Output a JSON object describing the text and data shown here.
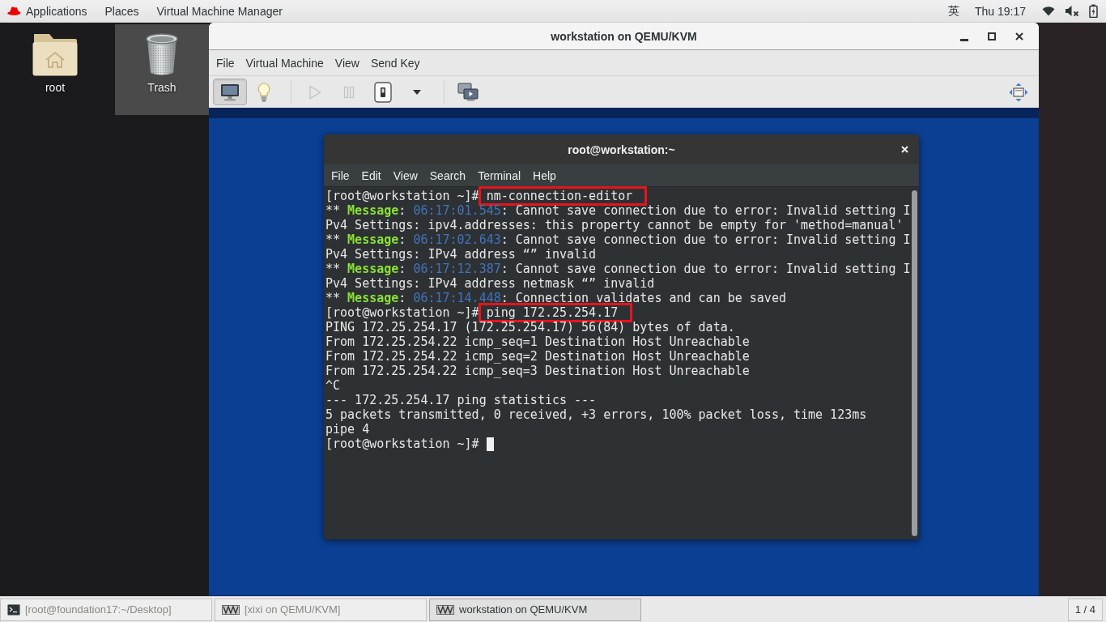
{
  "top_bar": {
    "menus": [
      "Applications",
      "Places",
      "Virtual Machine Manager"
    ],
    "input_method": "英",
    "clock": "Thu 19:17"
  },
  "desktop_icons": [
    {
      "label": "root",
      "selected": false
    },
    {
      "label": "Trash",
      "selected": true
    }
  ],
  "vm_window": {
    "title": "workstation on QEMU/KVM",
    "menu": [
      "File",
      "Virtual Machine",
      "View",
      "Send Key"
    ],
    "toolbar": {
      "groups": [
        {
          "buttons": [
            {
              "selected": true,
              "disabled": false
            },
            {
              "selected": false,
              "disabled": false
            }
          ]
        },
        {
          "buttons": [
            {
              "selected": false,
              "disabled": true
            },
            {
              "selected": false,
              "disabled": true
            },
            {
              "selected": false,
              "disabled": false
            },
            {
              "selected": false,
              "disabled": false
            }
          ]
        },
        {
          "buttons": [
            {
              "selected": false,
              "disabled": false
            }
          ]
        }
      ],
      "end_buttons": [
        {
          "selected": false,
          "disabled": false
        }
      ]
    },
    "terminal": {
      "title": "root@workstation:~",
      "menu": [
        "File",
        "Edit",
        "View",
        "Search",
        "Terminal",
        "Help"
      ],
      "lines": [
        {
          "kind": "prompt",
          "prompt": "[root@workstation ~]#",
          "command": "nm-connection-editor",
          "highlighted": true,
          "cursor": false
        },
        {
          "kind": "message",
          "segments": [
            "** ",
            "Message",
            ": ",
            "06:17:01.545",
            ": Cannot save connection due to error: Invalid setting I"
          ]
        },
        {
          "kind": "output",
          "text": "Pv4 Settings: ipv4.addresses: this property cannot be empty for 'method=manual'"
        },
        {
          "kind": "message",
          "segments": [
            "** ",
            "Message",
            ": ",
            "06:17:02.643",
            ": Cannot save connection due to error: Invalid setting I"
          ]
        },
        {
          "kind": "output",
          "text": "Pv4 Settings: IPv4 address “” invalid"
        },
        {
          "kind": "message",
          "segments": [
            "** ",
            "Message",
            ": ",
            "06:17:12.387",
            ": Cannot save connection due to error: Invalid setting I"
          ]
        },
        {
          "kind": "output",
          "text": "Pv4 Settings: IPv4 address netmask “” invalid"
        },
        {
          "kind": "message",
          "segments": [
            "** ",
            "Message",
            ": ",
            "06:17:14.448",
            ": Connection validates and can be saved"
          ]
        },
        {
          "kind": "prompt",
          "prompt": "[root@workstation ~]#",
          "command": "ping 172.25.254.17",
          "highlighted": true,
          "cursor": false
        },
        {
          "kind": "output",
          "text": "PING 172.25.254.17 (172.25.254.17) 56(84) bytes of data."
        },
        {
          "kind": "output",
          "text": "From 172.25.254.22 icmp_seq=1 Destination Host Unreachable"
        },
        {
          "kind": "output",
          "text": "From 172.25.254.22 icmp_seq=2 Destination Host Unreachable"
        },
        {
          "kind": "output",
          "text": "From 172.25.254.22 icmp_seq=3 Destination Host Unreachable"
        },
        {
          "kind": "output",
          "text": "^C"
        },
        {
          "kind": "output",
          "text": "--- 172.25.254.17 ping statistics ---"
        },
        {
          "kind": "output",
          "text": "5 packets transmitted, 0 received, +3 errors, 100% packet loss, time 123ms"
        },
        {
          "kind": "output",
          "text": "pipe 4"
        },
        {
          "kind": "prompt",
          "prompt": "[root@workstation ~]#",
          "highlighted": false,
          "cursor": true
        }
      ]
    }
  },
  "taskbar": {
    "items": [
      {
        "kind": "terminal",
        "label": "[root@foundation17:~/Desktop]",
        "selected": false
      },
      {
        "kind": "virtual-machine",
        "label": "[xixi on QEMU/KVM]",
        "selected": false
      },
      {
        "kind": "virtual-machine",
        "label": "workstation on QEMU/KVM",
        "selected": true
      }
    ],
    "workspace": "1 / 4"
  }
}
